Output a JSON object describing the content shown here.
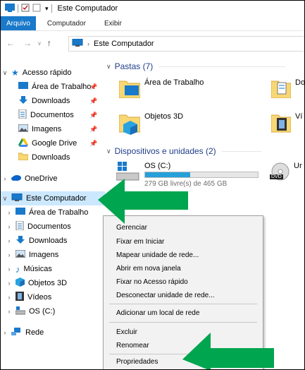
{
  "window": {
    "title": "Este Computador"
  },
  "ribbon": {
    "tabs": [
      "Arquivo",
      "Computador",
      "Exibir"
    ]
  },
  "address": {
    "path": "Este Computador"
  },
  "nav": {
    "quick_access": "Acesso rápido",
    "quick_items": [
      "Área de Trabalho",
      "Downloads",
      "Documentos",
      "Imagens",
      "Google Drive",
      "Downloads"
    ],
    "onedrive": "OneDrive",
    "this_pc": "Este Computador",
    "pc_items": [
      "Área de Trabalho",
      "Documentos",
      "Downloads",
      "Imagens",
      "Músicas",
      "Objetos 3D",
      "Vídeos",
      "OS (C:)"
    ],
    "network": "Rede"
  },
  "content": {
    "folders_header": "Pastas (7)",
    "folders": [
      "Área de Trabalho",
      "Do",
      "Objetos 3D",
      "Ví"
    ],
    "devices_header": "Dispositivos e unidades (2)",
    "drive_name": "OS (C:)",
    "drive_free": "279 GB livre(s) de 465 GB",
    "drive_used_fraction": 0.4,
    "dvd_label": "Ur",
    "dvd_badge": "DVD"
  },
  "context_menu": {
    "items": [
      "Gerenciar",
      "Fixar em Iniciar",
      "Mapear unidade de rede...",
      "Abrir em nova janela",
      "Fixar no Acesso rápido",
      "Desconectar unidade de rede...",
      "Adicionar um local de rede",
      "Excluir",
      "Renomear",
      "Propriedades"
    ]
  },
  "colors": {
    "accent": "#1979ca",
    "selection": "#cce8ff",
    "arrow": "#00a54f",
    "header": "#1f3d8a"
  }
}
